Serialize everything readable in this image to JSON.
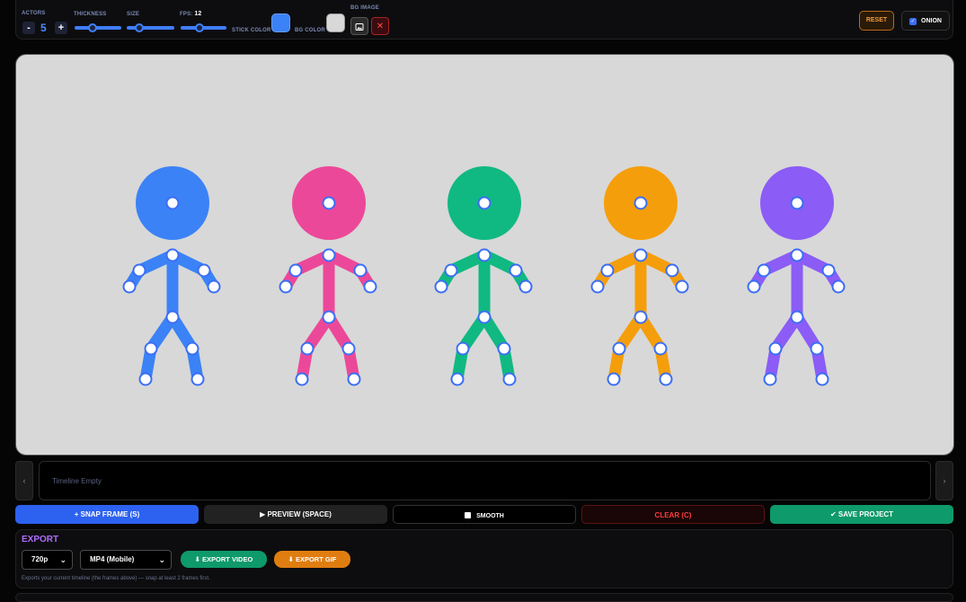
{
  "toolbar": {
    "actors_label": "ACTORS",
    "actors_minus": "-",
    "actors_count": "5",
    "actors_plus": "+",
    "thickness_label": "THICKNESS",
    "size_label": "SIZE",
    "fps_label": "FPS:",
    "fps_value": "12",
    "stick_color_label": "STICK COLOR",
    "stick_color": "#3b82f6",
    "bg_color_label": "BG COLOR",
    "bg_color": "#d8d8d8",
    "bg_image_label": "BG IMAGE",
    "bg_image_clear": "✕",
    "reset_label": "RESET",
    "onion_label": "ONION",
    "onion_checked": true,
    "thickness_level": 0.35,
    "size_level": 0.2,
    "fps_level": 0.4
  },
  "stage": {
    "background": "#d8d8d8",
    "actors": [
      {
        "color": "#3b82f6"
      },
      {
        "color": "#ec4899"
      },
      {
        "color": "#10b981"
      },
      {
        "color": "#f59e0b"
      },
      {
        "color": "#8b5cf6"
      }
    ]
  },
  "timeline": {
    "empty_text": "Timeline Empty",
    "prev": "‹",
    "next": "›"
  },
  "actions": {
    "snap": "+ SNAP FRAME (S)",
    "preview": "▶ PREVIEW (SPACE)",
    "smooth": "SMOOTH",
    "clear": "CLEAR (C)",
    "save": "✔ SAVE PROJECT"
  },
  "export": {
    "title": "EXPORT",
    "resolution": "720p",
    "format": "MP4 (Mobile)",
    "export_video": "⬇ EXPORT VIDEO",
    "export_gif": "⬇ EXPORT GIF",
    "note": "Exports your current timeline (the frames above) — snap at least 2 frames first."
  }
}
